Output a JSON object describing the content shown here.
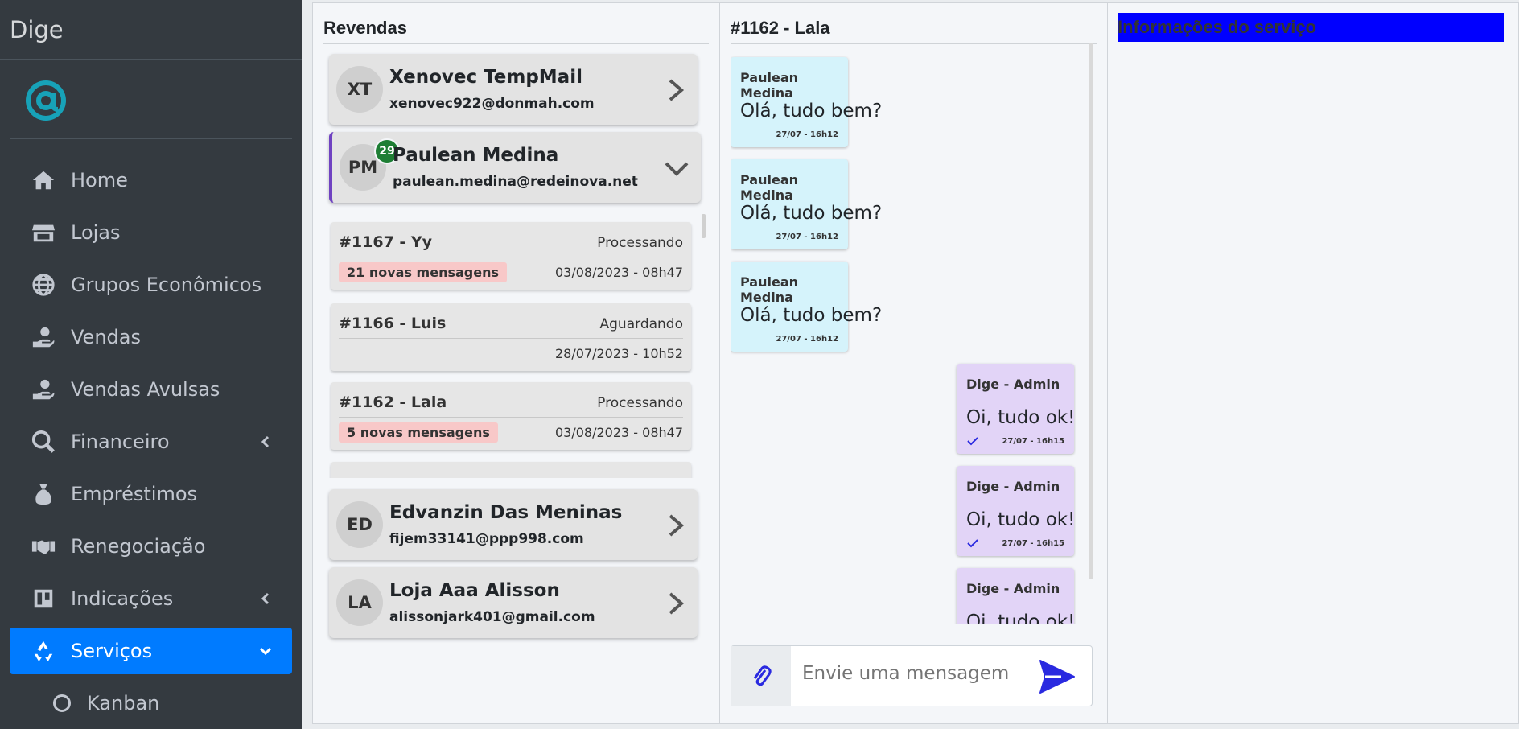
{
  "sidebar": {
    "brand": "Dige",
    "items": [
      {
        "label": "Home",
        "icon": "home-icon"
      },
      {
        "label": "Lojas",
        "icon": "store-icon"
      },
      {
        "label": "Grupos Econômicos",
        "icon": "globe-icon"
      },
      {
        "label": "Vendas",
        "icon": "hand-dollar-icon"
      },
      {
        "label": "Vendas Avulsas",
        "icon": "hand-dollar-icon"
      },
      {
        "label": "Financeiro",
        "icon": "search-dollar-icon"
      },
      {
        "label": "Empréstimos",
        "icon": "money-bag-icon"
      },
      {
        "label": "Renegociação",
        "icon": "handshake-icon"
      },
      {
        "label": "Indicações",
        "icon": "trello-icon"
      },
      {
        "label": "Serviços",
        "icon": "recycle-icon"
      }
    ],
    "sub_items": [
      {
        "label": "Kanban"
      }
    ],
    "active_color": "#007bff"
  },
  "revendas": {
    "title": "Revendas",
    "cards": [
      {
        "initials": "XT",
        "name": "Xenovec TempMail",
        "email": "xenovec922@donmah.com"
      },
      {
        "initials": "PM",
        "name": "Paulean Medina",
        "email": "paulean.medina@redeinova.net",
        "badge": "29"
      },
      {
        "initials": "ED",
        "name": "Edvanzin Das Meninas",
        "email": "fijem33141@ppp998.com"
      },
      {
        "initials": "LA",
        "name": "Loja Aaa Alisson",
        "email": "alissonjark401@gmail.com"
      }
    ],
    "orders": [
      {
        "title": "#1167 - Yy",
        "status": "Processando",
        "new": "21 novas mensagens",
        "date": "03/08/2023 - 08h47"
      },
      {
        "title": "#1166 - Luis",
        "status": "Aguardando",
        "new": "",
        "date": "28/07/2023 - 10h52"
      },
      {
        "title": "#1162 - Lala",
        "status": "Processando",
        "new": "5 novas mensagens",
        "date": "03/08/2023 - 08h47"
      }
    ]
  },
  "chat": {
    "title": "#1162 - Lala",
    "messages": [
      {
        "author": "Paulean Medina",
        "text": "Olá, tudo bem?",
        "time": "27/07 - 16h12",
        "dir": "in"
      },
      {
        "author": "Paulean Medina",
        "text": "Olá, tudo bem?",
        "time": "27/07 - 16h12",
        "dir": "in"
      },
      {
        "author": "Paulean Medina",
        "text": "Olá, tudo bem?",
        "time": "27/07 - 16h12",
        "dir": "in"
      },
      {
        "author": "Dige - Admin",
        "text": "Oi, tudo ok!",
        "time": "27/07 - 16h15",
        "dir": "out"
      },
      {
        "author": "Dige - Admin",
        "text": "Oi, tudo ok!",
        "time": "27/07 - 16h15",
        "dir": "out"
      },
      {
        "author": "Dige - Admin",
        "text": "Oi, tudo ok!",
        "time": "",
        "dir": "out"
      }
    ],
    "placeholder": "Envie uma mensagem",
    "send_color": "#2a2ae0"
  },
  "info": {
    "title": "Informações do serviço",
    "bg_color": "#0000ff"
  }
}
